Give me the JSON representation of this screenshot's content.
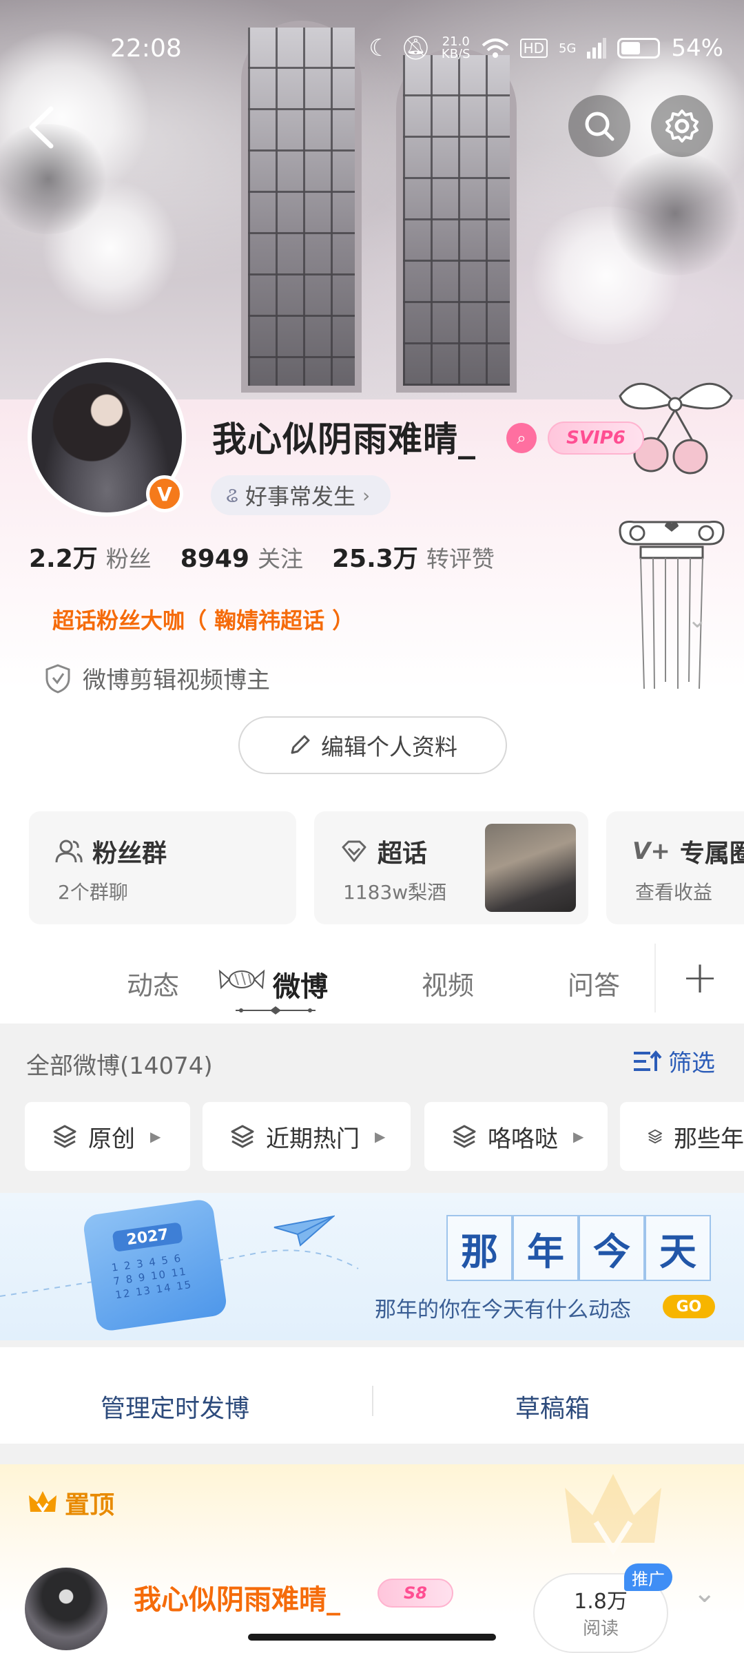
{
  "status_bar": {
    "time": "22:08",
    "net_speed": "21.0",
    "net_unit": "KB/S",
    "hd": "HD",
    "signal": "5G",
    "battery": "54%",
    "battery_level": 0.54
  },
  "profile": {
    "username": "我心似阴雨难晴_",
    "svip_label": "SVIP6",
    "tagline": "好事常发生",
    "stats": [
      {
        "num": "2.2万",
        "label": "粉丝"
      },
      {
        "num": "8949",
        "label": "关注"
      },
      {
        "num": "25.3万",
        "label": "转评赞"
      }
    ],
    "chaohua_title": "超话粉丝大咖（ 鞠婧祎超话 ）",
    "verify_text": "微博剪辑视频博主",
    "edit_button": "编辑个人资料",
    "verified_mark": "V"
  },
  "cards": [
    {
      "title": "粉丝群",
      "sub": "2个群聊",
      "icon": "group-icon"
    },
    {
      "title": "超话",
      "sub": "1183w梨酒",
      "icon": "diamond-icon"
    },
    {
      "title": "专属圈",
      "sub": "查看收益",
      "icon": "v-plus-icon"
    }
  ],
  "tabs": [
    {
      "label": "动态"
    },
    {
      "label": "微博",
      "active": true
    },
    {
      "label": "视频"
    },
    {
      "label": "问答"
    }
  ],
  "filter": {
    "all_label": "全部微博(14074)",
    "filter_label": "筛选",
    "chips": [
      "原创",
      "近期热门",
      "咯咯哒",
      "那些年"
    ]
  },
  "banner": {
    "calendar_year": "2027",
    "title_chars": [
      "那",
      "年",
      "今",
      "天"
    ],
    "subtitle": "那年的你在今天有什么动态",
    "go": "GO"
  },
  "manage": {
    "scheduled": "管理定时发博",
    "drafts": "草稿箱"
  },
  "pinned": {
    "label": "置顶",
    "post_author": "我心似阴雨难晴_",
    "author_badge": "S8",
    "reads_num": "1.8万",
    "reads_label": "阅读",
    "promo": "推广"
  },
  "colors": {
    "accent_orange": "#f56b0a",
    "link_blue": "#2b5cb8",
    "svip_pink": "#ff4e92"
  }
}
